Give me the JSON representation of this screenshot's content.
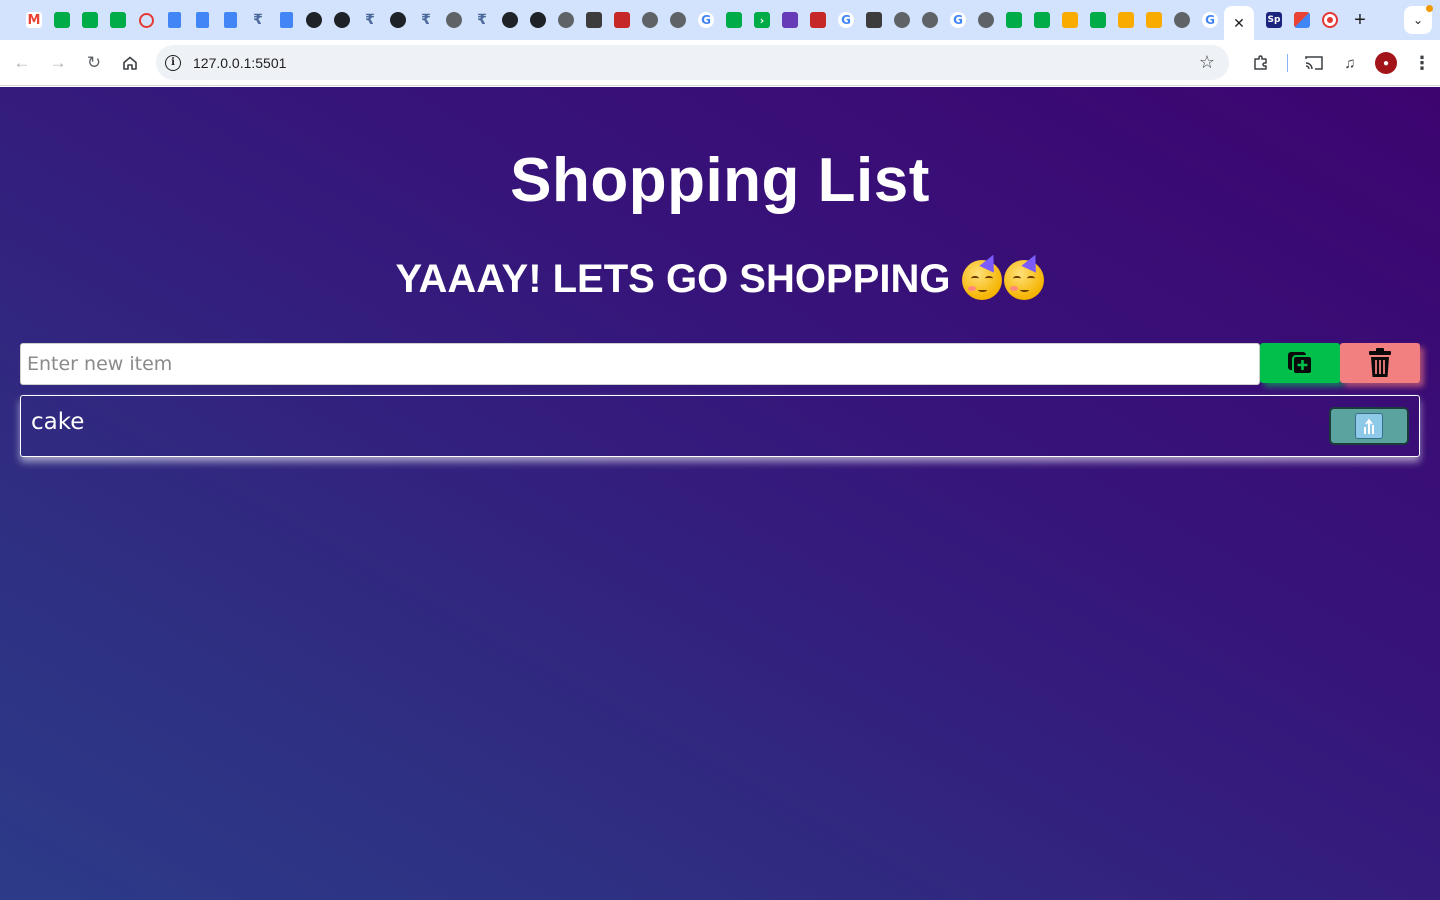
{
  "browser": {
    "url": "127.0.0.1:5501",
    "tabs": [
      {
        "icon": "gmail-icon",
        "glyph": "M"
      },
      {
        "icon": "google-meet-icon",
        "glyph": ""
      },
      {
        "icon": "google-meet-icon",
        "glyph": ""
      },
      {
        "icon": "google-meet-icon",
        "glyph": ""
      },
      {
        "icon": "red-ring-icon",
        "glyph": ""
      },
      {
        "icon": "google-docs-icon",
        "glyph": ""
      },
      {
        "icon": "google-docs-icon",
        "glyph": ""
      },
      {
        "icon": "google-docs-icon",
        "glyph": ""
      },
      {
        "icon": "rupee-icon",
        "glyph": "₹"
      },
      {
        "icon": "google-docs-icon",
        "glyph": ""
      },
      {
        "icon": "github-icon",
        "glyph": ""
      },
      {
        "icon": "github-icon",
        "glyph": ""
      },
      {
        "icon": "rupee-icon",
        "glyph": "₹"
      },
      {
        "icon": "github-icon",
        "glyph": ""
      },
      {
        "icon": "rupee-icon",
        "glyph": "₹"
      },
      {
        "icon": "globe-icon",
        "glyph": ""
      },
      {
        "icon": "rupee-icon",
        "glyph": "₹"
      },
      {
        "icon": "github-icon",
        "glyph": ""
      },
      {
        "icon": "github-icon",
        "glyph": ""
      },
      {
        "icon": "globe-icon",
        "glyph": ""
      },
      {
        "icon": "dark-app-icon",
        "glyph": ""
      },
      {
        "icon": "red-app-icon",
        "glyph": ""
      },
      {
        "icon": "globe-icon",
        "glyph": ""
      },
      {
        "icon": "globe-icon",
        "glyph": ""
      },
      {
        "icon": "google-icon",
        "glyph": "G"
      },
      {
        "icon": "google-meet-icon",
        "glyph": ""
      },
      {
        "icon": "green-arrows-icon",
        "glyph": "›"
      },
      {
        "icon": "purple-app-icon",
        "glyph": ""
      },
      {
        "icon": "red-app-icon",
        "glyph": ""
      },
      {
        "icon": "google-icon",
        "glyph": "G"
      },
      {
        "icon": "dark-app-icon",
        "glyph": ""
      },
      {
        "icon": "globe-icon",
        "glyph": ""
      },
      {
        "icon": "globe-icon",
        "glyph": ""
      },
      {
        "icon": "google-icon",
        "glyph": "G"
      },
      {
        "icon": "globe-icon",
        "glyph": ""
      },
      {
        "icon": "google-meet-icon",
        "glyph": ""
      },
      {
        "icon": "google-meet-icon",
        "glyph": ""
      },
      {
        "icon": "yellow-app-icon",
        "glyph": ""
      },
      {
        "icon": "google-meet-icon",
        "glyph": ""
      },
      {
        "icon": "yellow-app-icon",
        "glyph": ""
      },
      {
        "icon": "stack-icon",
        "glyph": ""
      },
      {
        "icon": "globe-icon",
        "glyph": ""
      },
      {
        "icon": "google-icon",
        "glyph": "G"
      }
    ],
    "right_tabs": [
      {
        "icon": "navy-app-icon",
        "glyph": "Sp"
      },
      {
        "icon": "multicolor-app-icon",
        "glyph": ""
      },
      {
        "icon": "target-icon",
        "glyph": ""
      }
    ]
  },
  "page": {
    "title": "Shopping List",
    "subtitle": "YAAAY! LETS GO SHOPPING",
    "input_placeholder": "Enter new item",
    "input_value": "",
    "items": [
      {
        "label": "cake"
      }
    ]
  },
  "colors": {
    "add_button": "#00c04b",
    "clear_button": "#f28080",
    "remove_button": "#5aa39f",
    "background_top": "#3d0470",
    "background_bottom": "#2c3b88"
  }
}
